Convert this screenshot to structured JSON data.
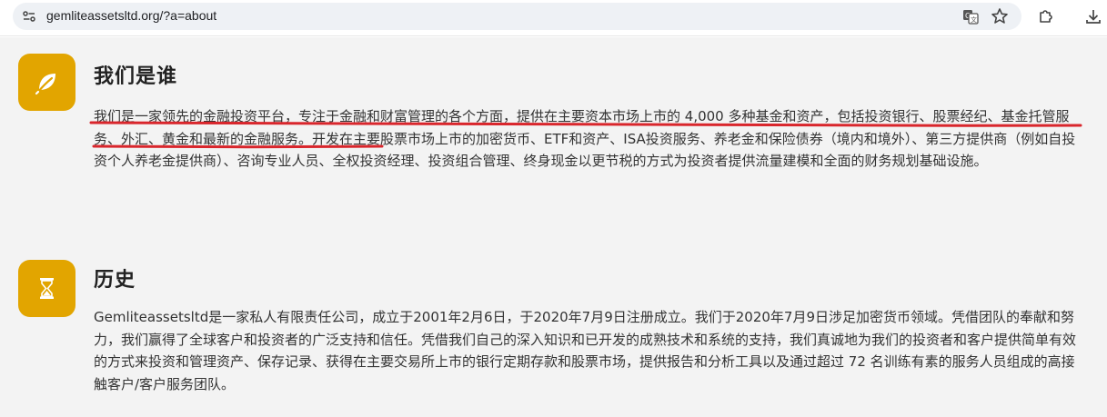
{
  "browser": {
    "url": "gemliteassetsltd.org/?a=about",
    "icons": [
      "site-info-icon",
      "translate-icon",
      "bookmark-star-icon",
      "extensions-icon",
      "download-icon"
    ]
  },
  "sections": [
    {
      "icon": "leaf-icon",
      "title": "我们是谁",
      "body_highlight": "我们是一家领先的金融投资平台，专注于金融和财富管理的各个方面，提供在主要资本市场上市的 4,000 多种基金和资产，包括投资银行、股票经纪、基金托管服务、外汇、黄金和最新的金融服务。",
      "body_rest": "开发在主要股票市场上市的加密货币、ETF和资产、ISA投资服务、养老金和保险债券（境内和境外）、第三方提供商（例如自投资个人养老金提供商）、咨询专业人员、全权投资经理、投资组合管理、终身现金以更节税的方式为投资者提供流量建模和全面的财务规划基础设施。"
    },
    {
      "icon": "hourglass-icon",
      "title": "历史",
      "body": "Gemliteassetsltd是一家私人有限责任公司，成立于2001年2月6日，于2020年7月9日注册成立。我们于2020年7月9日涉足加密货币领域。凭借团队的奉献和努力，我们赢得了全球客户和投资者的广泛支持和信任。凭借我们自己的深入知识和已开发的成熟技术和系统的支持，我们真诚地为我们的投资者和客户提供简单有效的方式来投资和管理资产、保存记录、获得在主要交易所上市的银行定期存款和股票市场，提供报告和分析工具以及通过超过 72 名训练有素的服务人员组成的高接触客户/客户服务团队。"
    }
  ],
  "colors": {
    "icon_tile": "#e2a500",
    "annotation_underline": "#d9262c",
    "page_bg": "#f3f3f3"
  }
}
